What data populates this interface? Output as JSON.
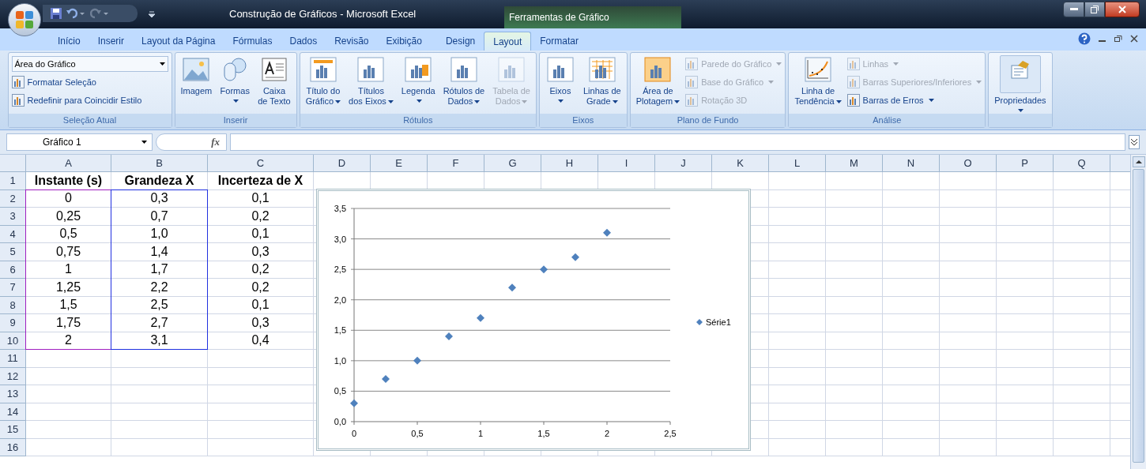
{
  "window": {
    "title": "Construção de Gráficos - Microsoft Excel",
    "contextual_group": "Ferramentas de Gráfico"
  },
  "tabs": [
    {
      "label": "Início",
      "selected": false
    },
    {
      "label": "Inserir",
      "selected": false
    },
    {
      "label": "Layout da Página",
      "selected": false
    },
    {
      "label": "Fórmulas",
      "selected": false
    },
    {
      "label": "Dados",
      "selected": false
    },
    {
      "label": "Revisão",
      "selected": false
    },
    {
      "label": "Exibição",
      "selected": false
    },
    {
      "label": "Design",
      "selected": false
    },
    {
      "label": "Layout",
      "selected": true
    },
    {
      "label": "Formatar",
      "selected": false
    }
  ],
  "ribbon": [
    {
      "label": "Seleção Atual",
      "items": [
        {
          "kind": "combo",
          "label": "Área do Gráfico"
        },
        {
          "kind": "small",
          "label": "Formatar Seleção",
          "dropdown": false,
          "disabled": false
        },
        {
          "kind": "small",
          "label": "Redefinir para Coincidir Estilo",
          "dropdown": false,
          "disabled": false
        }
      ]
    },
    {
      "label": "Inserir",
      "items": [
        {
          "kind": "large",
          "lines": [
            "Imagem"
          ],
          "dropdown": false,
          "disabled": false
        },
        {
          "kind": "large",
          "lines": [
            "Formas"
          ],
          "dropdown": true,
          "disabled": false
        },
        {
          "kind": "large",
          "lines": [
            "Caixa",
            "de Texto"
          ],
          "dropdown": false,
          "disabled": false
        }
      ]
    },
    {
      "label": "Rótulos",
      "items": [
        {
          "kind": "large",
          "lines": [
            "Título do",
            "Gráfico"
          ],
          "dropdown": true,
          "disabled": false
        },
        {
          "kind": "large",
          "lines": [
            "Títulos",
            "dos Eixos"
          ],
          "dropdown": true,
          "disabled": false
        },
        {
          "kind": "large",
          "lines": [
            "Legenda"
          ],
          "dropdown": true,
          "disabled": false
        },
        {
          "kind": "large",
          "lines": [
            "Rótulos de",
            "Dados"
          ],
          "dropdown": true,
          "disabled": false
        },
        {
          "kind": "large",
          "lines": [
            "Tabela de",
            "Dados"
          ],
          "dropdown": true,
          "disabled": true
        }
      ]
    },
    {
      "label": "Eixos",
      "items": [
        {
          "kind": "large",
          "lines": [
            "Eixos"
          ],
          "dropdown": true,
          "disabled": false
        },
        {
          "kind": "large",
          "lines": [
            "Linhas de",
            "Grade"
          ],
          "dropdown": true,
          "disabled": false
        }
      ]
    },
    {
      "label": "Plano de Fundo",
      "items": [
        {
          "kind": "large",
          "lines": [
            "Área de",
            "Plotagem"
          ],
          "dropdown": true,
          "disabled": false
        },
        {
          "kind": "small",
          "label": "Parede do Gráfico",
          "dropdown": true,
          "disabled": true
        },
        {
          "kind": "small",
          "label": "Base do Gráfico",
          "dropdown": true,
          "disabled": true
        },
        {
          "kind": "small",
          "label": "Rotação 3D",
          "dropdown": false,
          "disabled": true
        }
      ]
    },
    {
      "label": "Análise",
      "items": [
        {
          "kind": "large",
          "lines": [
            "Linha de",
            "Tendência"
          ],
          "dropdown": true,
          "disabled": false
        },
        {
          "kind": "small",
          "label": "Linhas",
          "dropdown": true,
          "disabled": true
        },
        {
          "kind": "small",
          "label": "Barras Superiores/Inferiores",
          "dropdown": true,
          "disabled": true
        },
        {
          "kind": "small",
          "label": "Barras de Erros",
          "dropdown": true,
          "disabled": false
        }
      ]
    },
    {
      "items": [
        {
          "kind": "large",
          "lines": [
            "Propriedades"
          ],
          "dropdown": true,
          "disabled": false
        }
      ]
    }
  ],
  "formula_bar": {
    "name_box": "Gráfico 1",
    "function_label": "fx"
  },
  "sheet": {
    "columns": [
      {
        "label": "A",
        "color": "#a020c0"
      },
      {
        "label": "B",
        "color": "#2030e0"
      },
      {
        "label": "C"
      },
      {
        "label": "D"
      },
      {
        "label": "E"
      },
      {
        "label": "F"
      },
      {
        "label": "G"
      },
      {
        "label": "H"
      },
      {
        "label": "I"
      },
      {
        "label": "J"
      },
      {
        "label": "K"
      },
      {
        "label": "L"
      },
      {
        "label": "M"
      },
      {
        "label": "N"
      },
      {
        "label": "O"
      },
      {
        "label": "P"
      },
      {
        "label": "Q"
      }
    ],
    "rows": [
      {
        "number": "1",
        "cells": [
          "Instante (s)",
          "Grandeza X",
          "Incerteza de X"
        ],
        "header": true
      },
      {
        "number": "2",
        "cells": [
          "0",
          "0,3",
          "0,1"
        ],
        "header": false
      },
      {
        "number": "3",
        "cells": [
          "0,25",
          "0,7",
          "0,2"
        ],
        "header": false
      },
      {
        "number": "4",
        "cells": [
          "0,5",
          "1,0",
          "0,1"
        ],
        "header": false
      },
      {
        "number": "5",
        "cells": [
          "0,75",
          "1,4",
          "0,3"
        ],
        "header": false
      },
      {
        "number": "6",
        "cells": [
          "1",
          "1,7",
          "0,2"
        ],
        "header": false
      },
      {
        "number": "7",
        "cells": [
          "1,25",
          "2,2",
          "0,2"
        ],
        "header": false
      },
      {
        "number": "8",
        "cells": [
          "1,5",
          "2,5",
          "0,1"
        ],
        "header": false
      },
      {
        "number": "9",
        "cells": [
          "1,75",
          "2,7",
          "0,3"
        ],
        "header": false
      },
      {
        "number": "10",
        "cells": [
          "2",
          "3,1",
          "0,4"
        ],
        "header": false
      },
      {
        "number": "11",
        "cells": []
      },
      {
        "number": "12",
        "cells": []
      },
      {
        "number": "13",
        "cells": []
      },
      {
        "number": "14",
        "cells": []
      },
      {
        "number": "15",
        "cells": []
      },
      {
        "number": "16",
        "cells": []
      }
    ]
  },
  "chart": {
    "chart_data": {
      "type": "scatter",
      "grid": true,
      "x": [
        0,
        0.25,
        0.5,
        0.75,
        1,
        1.25,
        1.5,
        1.75,
        2
      ],
      "series": [
        {
          "name": "Série1",
          "color": "#4f81bd",
          "values": [
            0.3,
            0.7,
            1.0,
            1.4,
            1.7,
            2.2,
            2.5,
            2.7,
            3.1
          ]
        }
      ],
      "xlim": [
        0,
        2.5
      ],
      "ylim": [
        0,
        3.5
      ],
      "xticks": [
        {
          "value": 0,
          "label": "0"
        },
        {
          "value": 0.5,
          "label": "0,5"
        },
        {
          "value": 1,
          "label": "1"
        },
        {
          "value": 1.5,
          "label": "1,5"
        },
        {
          "value": 2,
          "label": "2"
        },
        {
          "value": 2.5,
          "label": "2,5"
        }
      ],
      "yticks": [
        {
          "value": 0,
          "label": "0,0"
        },
        {
          "value": 0.5,
          "label": "0,5"
        },
        {
          "value": 1,
          "label": "1,0"
        },
        {
          "value": 1.5,
          "label": "1,5"
        },
        {
          "value": 2,
          "label": "2,0"
        },
        {
          "value": 2.5,
          "label": "2,5"
        },
        {
          "value": 3,
          "label": "3,0"
        },
        {
          "value": 3.5,
          "label": "3,5"
        }
      ]
    }
  }
}
